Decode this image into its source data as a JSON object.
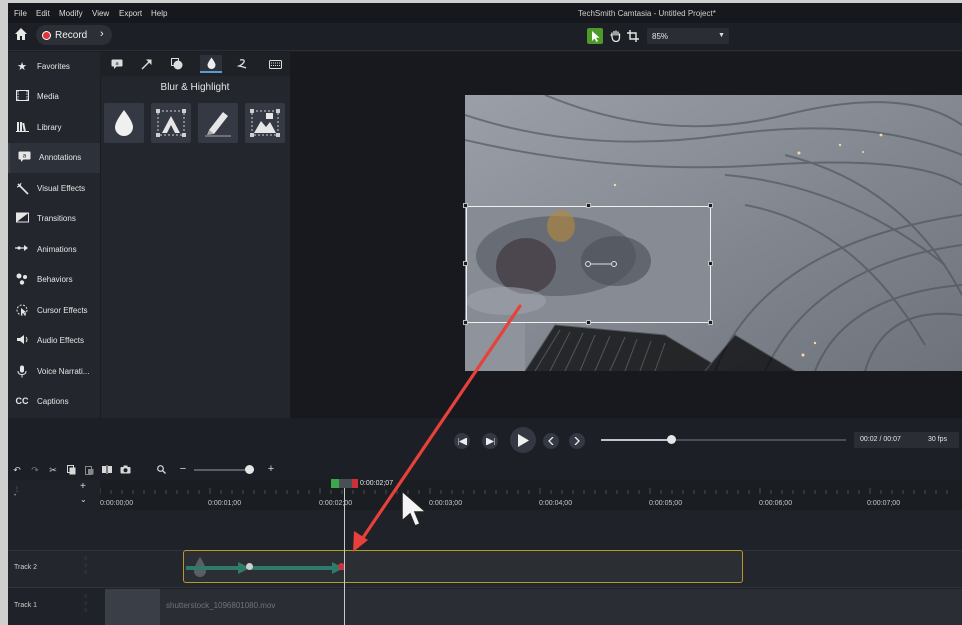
{
  "window": {
    "title": "TechSmith Camtasia - Untitled Project*"
  },
  "menu": [
    "File",
    "Edit",
    "Modify",
    "View",
    "Export",
    "Help"
  ],
  "toolbar": {
    "record_label": "Record",
    "zoom": "85%"
  },
  "sidebar": {
    "items": [
      {
        "label": "Favorites",
        "icon": "star-icon"
      },
      {
        "label": "Media",
        "icon": "film-icon"
      },
      {
        "label": "Library",
        "icon": "library-icon"
      },
      {
        "label": "Annotations",
        "icon": "annotation-icon"
      },
      {
        "label": "Visual Effects",
        "icon": "wand-icon"
      },
      {
        "label": "Transitions",
        "icon": "transition-icon"
      },
      {
        "label": "Animations",
        "icon": "animation-icon"
      },
      {
        "label": "Behaviors",
        "icon": "behavior-icon"
      },
      {
        "label": "Cursor Effects",
        "icon": "cursor-effect-icon"
      },
      {
        "label": "Audio Effects",
        "icon": "audio-icon"
      },
      {
        "label": "Voice Narrati...",
        "icon": "microphone-icon"
      },
      {
        "label": "Captions",
        "icon": "captions-icon"
      }
    ],
    "active_index": 3
  },
  "panel": {
    "title": "Blur & Highlight",
    "tabs": [
      "callout-tab",
      "arrow-tab",
      "shape-tab",
      "blur-tab",
      "sketch-tab",
      "keystroke-tab"
    ],
    "assets": [
      "blur-drop-asset",
      "spotlight-asset",
      "highlight-asset",
      "interactive-hotspot-asset"
    ]
  },
  "player": {
    "timecode": "00:02 / 00:07",
    "fps": "30 fps",
    "progress": 0.29
  },
  "timeline": {
    "playhead_time": "0:00:02;07",
    "ticks": [
      "0:00:00;00",
      "0:00:01;00",
      "0:00:02;00",
      "0:00:03;00",
      "0:00:04;00",
      "0:00:05;00",
      "0:00:06;00",
      "0:00:07;00"
    ],
    "tracks": [
      {
        "name": "Track 2"
      },
      {
        "name": "Track 1",
        "clip": "shutterstock_1096801080.mov"
      }
    ]
  }
}
